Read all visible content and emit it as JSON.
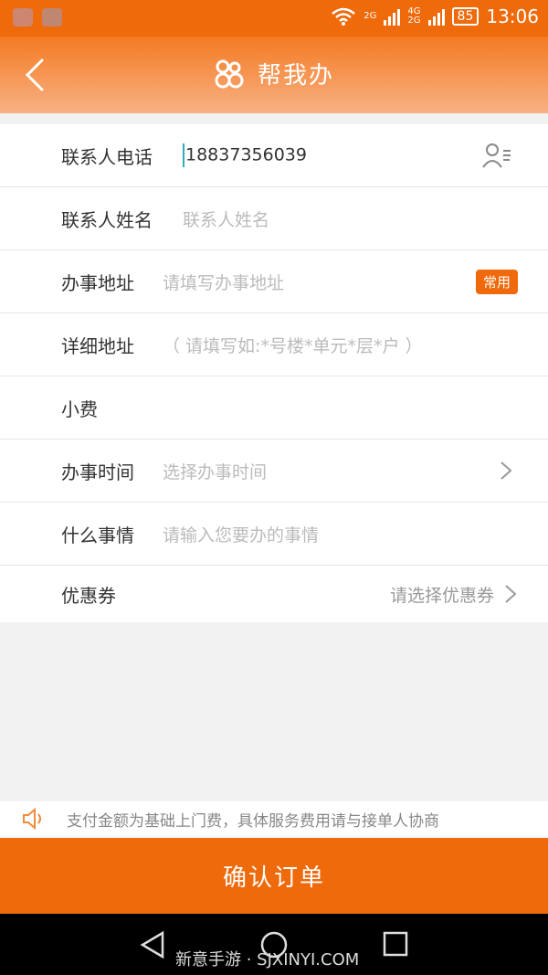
{
  "status_bar": {
    "time": "13:06",
    "network_top": "2G",
    "network_bottom_4g": "4G",
    "network_bottom_2g": "2G",
    "battery": "85"
  },
  "header": {
    "title": "帮我办",
    "background_color": "#f47a22"
  },
  "form": {
    "phone": {
      "label": "联系人电话",
      "value": "18837356039"
    },
    "name": {
      "label": "联系人姓名",
      "placeholder": "联系人姓名"
    },
    "address": {
      "label": "办事地址",
      "placeholder": "请填写办事地址",
      "badge": "常用"
    },
    "detail_address": {
      "label": "详细地址",
      "placeholder": "（ 请填写如:*号楼*单元*层*户 ）"
    },
    "tip": {
      "label": "小费"
    },
    "time": {
      "label": "办事时间",
      "placeholder": "选择办事时间"
    },
    "task": {
      "label": "什么事情",
      "placeholder": "请输入您要办的事情"
    },
    "coupon": {
      "label": "优惠券",
      "value": "请选择优惠券"
    }
  },
  "notice": "支付金额为基础上门费，具体服务费用请与接单人协商",
  "confirm_button": "确认订单",
  "watermark": "新意手游 · SJXINYI.COM",
  "colors": {
    "accent": "#ee6a0b",
    "placeholder": "#bbbbbb"
  }
}
